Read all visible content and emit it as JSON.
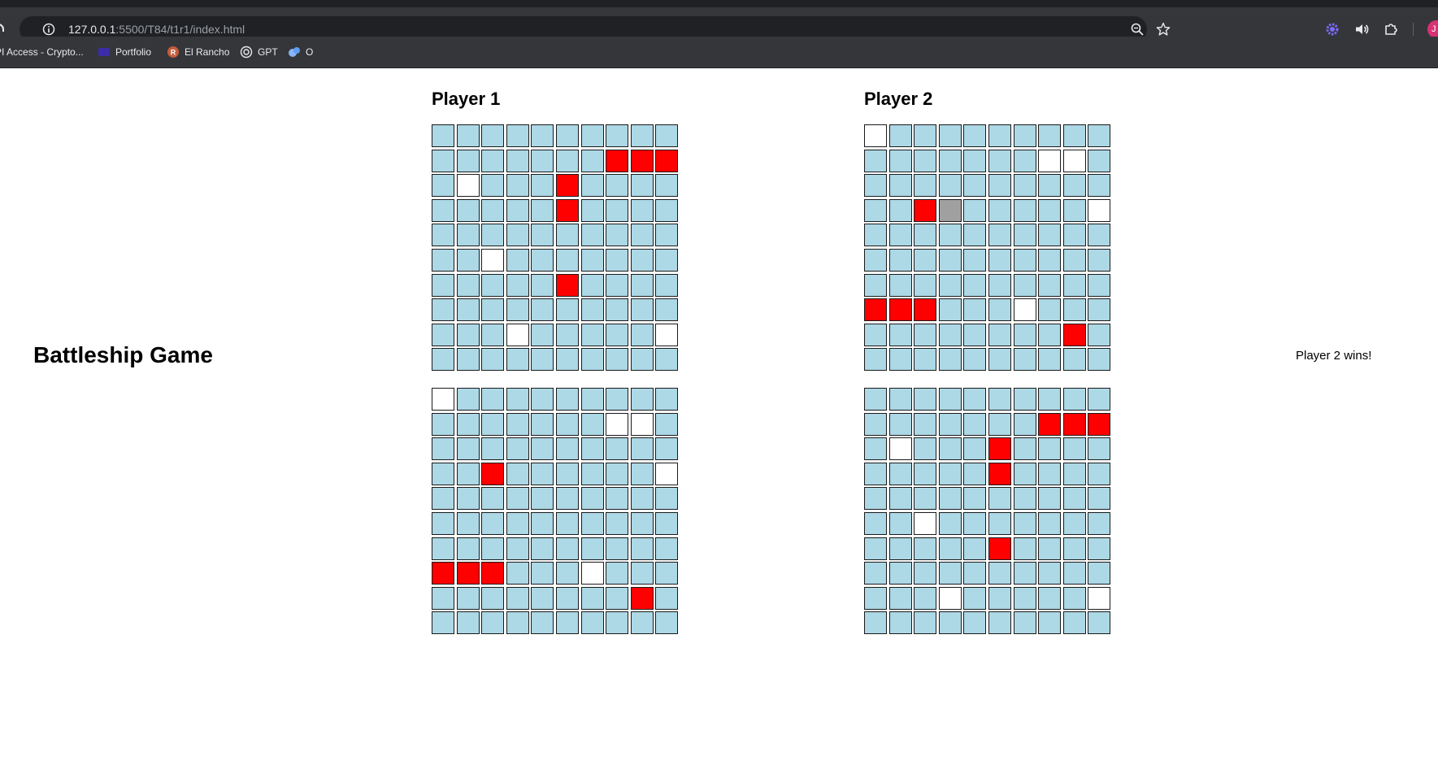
{
  "browser": {
    "url_host": "127.0.0.1",
    "url_path": ":5500/T84/t1r1/index.html",
    "profile_initial": "J",
    "bookmarks": [
      {
        "label": "PI Access - Crypto...",
        "icon": "page-favicon-icon",
        "color": "#8ab4f8"
      },
      {
        "label": "Portfolio",
        "icon": "portfolio-favicon-icon",
        "color": "#3c2ca8"
      },
      {
        "label": "El Rancho",
        "icon": "el-rancho-favicon-icon",
        "color": "#c45c3b"
      },
      {
        "label": "GPT",
        "icon": "openai-icon",
        "color": "#e8eaed"
      },
      {
        "label": "O",
        "icon": "o-favicon-icon",
        "color": "#8ab4f8"
      }
    ]
  },
  "game": {
    "title": "Battleship Game",
    "status": "Player 2 wins!"
  },
  "players": [
    {
      "name": "Player 1",
      "boards": [
        {
          "rows": [
            "~~~~~~~~~~",
            "~~~~~~~XXX",
            "~o~~~X~~~~",
            "~~~~~X~~~~",
            "~~~~~~~~~~",
            "~~o~~~~~~~",
            "~~~~~X~~~~",
            "~~~~~~~~~~",
            "~~~o~~~~~o",
            "~~~~~~~~~~"
          ]
        },
        {
          "rows": [
            "o~~~~~~~~~",
            "~~~~~~~oo~",
            "~~~~~~~~~~",
            "~~X~~~~~~o",
            "~~~~~~~~~~",
            "~~~~~~~~~~",
            "~~~~~~~~~~",
            "XXX~~~o~~~",
            "~~~~~~~~X~",
            "~~~~~~~~~~"
          ]
        }
      ]
    },
    {
      "name": "Player 2",
      "boards": [
        {
          "rows": [
            "o~~~~~~~~~",
            "~~~~~~~oo~",
            "~~~~~~~~~~",
            "~~Xs~~~~~o",
            "~~~~~~~~~~",
            "~~~~~~~~~~",
            "~~~~~~~~~~",
            "XXX~~~o~~~",
            "~~~~~~~~X~",
            "~~~~~~~~~~"
          ]
        },
        {
          "rows": [
            "~~~~~~~~~~",
            "~~~~~~~XXX",
            "~o~~~X~~~~",
            "~~~~~X~~~~",
            "~~~~~~~~~~",
            "~~o~~~~~~~",
            "~~~~~X~~~~",
            "~~~~~~~~~~",
            "~~~o~~~~~o",
            "~~~~~~~~~~"
          ]
        }
      ]
    }
  ],
  "legend": {
    "~": "water",
    "X": "hit",
    "o": "miss",
    "s": "sunk"
  },
  "colors": {
    "water": "#add8e6",
    "hit": "#ff0000",
    "miss": "#ffffff",
    "sunk": "#a0a0a0"
  }
}
